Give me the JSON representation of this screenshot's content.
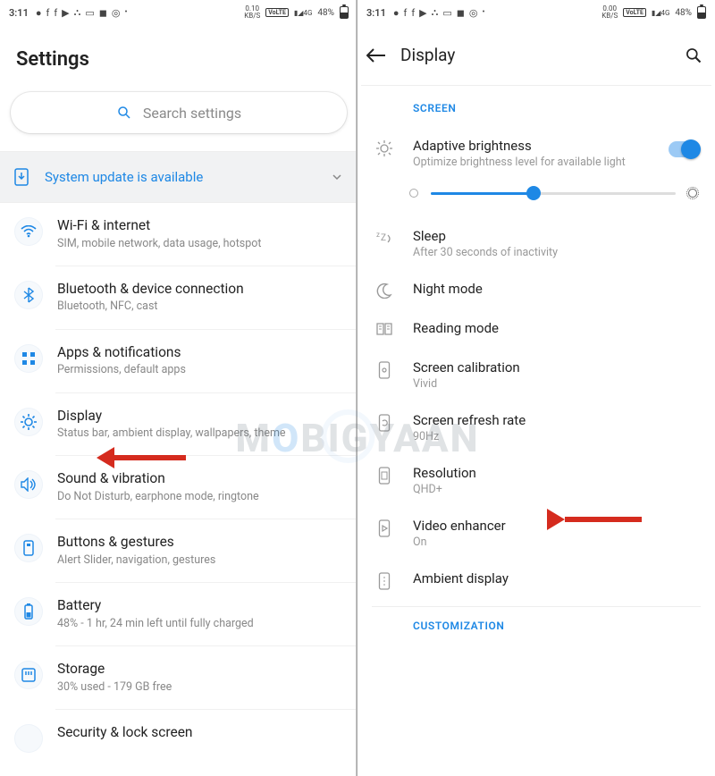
{
  "status": {
    "time": "3:11",
    "data_rate_left": "0.10",
    "data_rate_right": "0.00",
    "data_unit": "KB/S",
    "volte": "VoLTE",
    "net": "4G",
    "battery_pct": "48%"
  },
  "left": {
    "title": "Settings",
    "search_placeholder": "Search settings",
    "banner": "System update is available",
    "items": [
      {
        "icon": "wifi-icon",
        "title": "Wi-Fi & internet",
        "subtitle": "SIM, mobile network, data usage, hotspot"
      },
      {
        "icon": "bluetooth-icon",
        "title": "Bluetooth & device connection",
        "subtitle": "Bluetooth, NFC, cast"
      },
      {
        "icon": "apps-icon",
        "title": "Apps & notifications",
        "subtitle": "Permissions, default apps"
      },
      {
        "icon": "display-icon",
        "title": "Display",
        "subtitle": "Status bar, ambient display, wallpapers, theme"
      },
      {
        "icon": "sound-icon",
        "title": "Sound & vibration",
        "subtitle": "Do Not Disturb, earphone mode, ringtone"
      },
      {
        "icon": "buttons-icon",
        "title": "Buttons & gestures",
        "subtitle": "Alert Slider, navigation, gestures"
      },
      {
        "icon": "battery-icon",
        "title": "Battery",
        "subtitle": "48% - 1 hr, 24 min left until fully charged"
      },
      {
        "icon": "storage-icon",
        "title": "Storage",
        "subtitle": "30% used - 179 GB free"
      },
      {
        "icon": "security-icon",
        "title": "Security & lock screen",
        "subtitle": ""
      }
    ]
  },
  "right": {
    "title": "Display",
    "section1": "SCREEN",
    "section2": "CUSTOMIZATION",
    "adaptive": {
      "title": "Adaptive brightness",
      "subtitle": "Optimize brightness level for available light",
      "on": true
    },
    "brightness_pct": 42,
    "items": [
      {
        "icon": "sleep-icon",
        "title": "Sleep",
        "subtitle": "After 30 seconds of inactivity"
      },
      {
        "icon": "night-icon",
        "title": "Night mode",
        "subtitle": ""
      },
      {
        "icon": "reading-icon",
        "title": "Reading mode",
        "subtitle": ""
      },
      {
        "icon": "calibration-icon",
        "title": "Screen calibration",
        "subtitle": "Vivid"
      },
      {
        "icon": "refresh-icon",
        "title": "Screen refresh rate",
        "subtitle": "90Hz"
      },
      {
        "icon": "resolution-icon",
        "title": "Resolution",
        "subtitle": "QHD+"
      },
      {
        "icon": "video-icon",
        "title": "Video enhancer",
        "subtitle": "On"
      },
      {
        "icon": "ambient-icon",
        "title": "Ambient display",
        "subtitle": ""
      }
    ]
  },
  "watermark": "MOBIGYAAN"
}
